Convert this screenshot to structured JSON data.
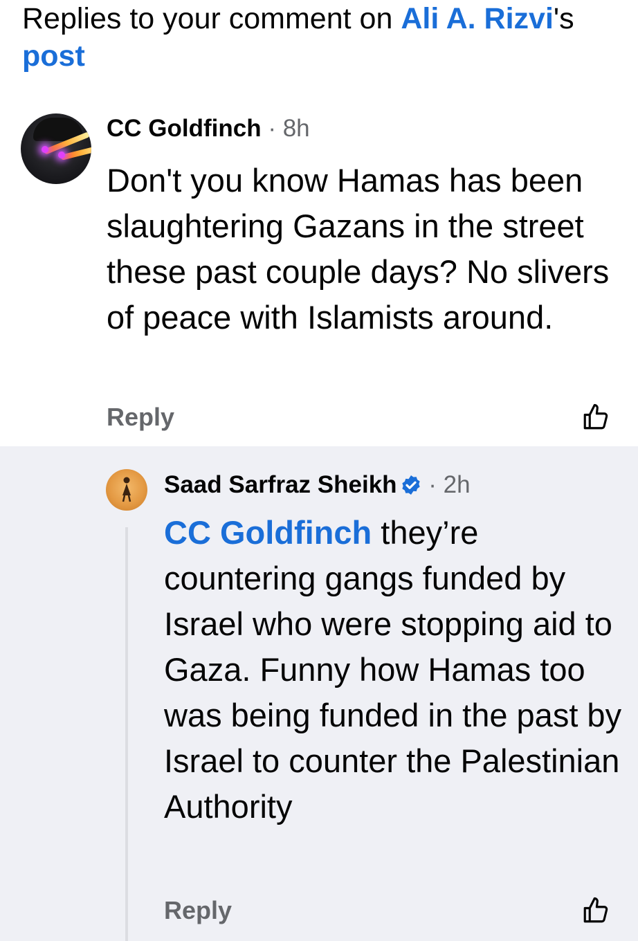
{
  "header": {
    "prefix": "Replies to your comment on ",
    "post_author": "Ali A. Rizvi",
    "possessive": "'s ",
    "post_link": "post"
  },
  "comment": {
    "author": "CC Goldfinch",
    "separator": " · ",
    "time": "8h",
    "text": "Don't you know Hamas has been slaughtering Gazans in the street these past couple days? No slivers of peace with Islamists around.",
    "reply_label": "Reply",
    "like_icon": "thumbs-up-icon"
  },
  "reply": {
    "author": "Saad Sarfraz Sheikh",
    "verified_icon": "verified-badge-icon",
    "separator": " · ",
    "time": "2h",
    "mention": "CC Goldfinch",
    "text": " they’re countering gangs funded by Israel who were stopping aid to Gaza. Funny how Hamas too was being funded in the past by Israel to counter the Palestinian Authority",
    "reply_label": "Reply",
    "like_icon": "thumbs-up-icon"
  },
  "colors": {
    "link": "#1a6ed8",
    "muted": "#65676b",
    "reply_background": "#eff0f5"
  }
}
